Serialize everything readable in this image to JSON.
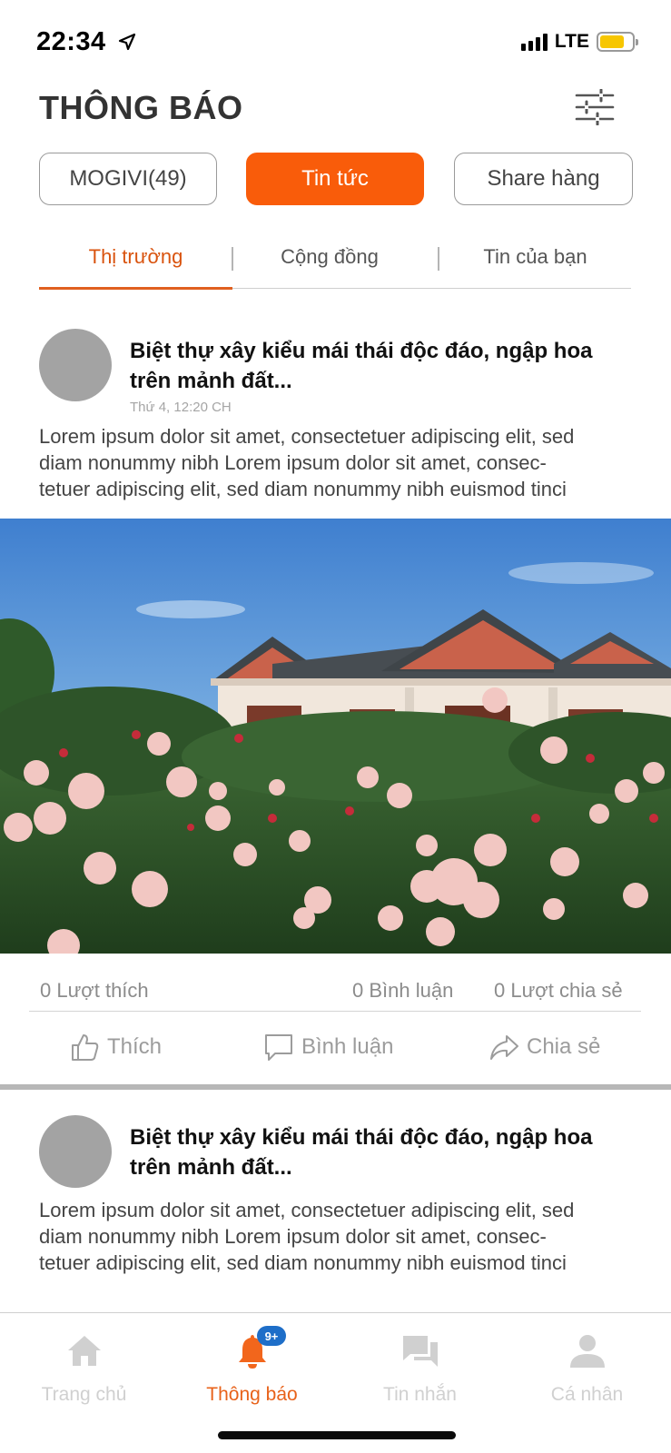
{
  "status_bar": {
    "time": "22:34",
    "network": "LTE",
    "icons": [
      "location-arrow-icon",
      "signal-bars-icon",
      "battery-icon"
    ],
    "battery_color": "#f7c600"
  },
  "header": {
    "title": "THÔNG BÁO",
    "filter_icon": "sliders-icon"
  },
  "segments": [
    {
      "label": "MOGIVI(49)",
      "active": false
    },
    {
      "label": "Tin tức",
      "active": true
    },
    {
      "label": "Share hàng",
      "active": false
    }
  ],
  "tabs": [
    {
      "label": "Thị trường",
      "active": true
    },
    {
      "label": "Cộng đồng",
      "active": false
    },
    {
      "label": "Tin của bạn",
      "active": false
    }
  ],
  "posts": [
    {
      "title_line1": "Biệt thự xây kiểu mái thái độc đáo, ngập hoa",
      "title_line2": "trên mảnh đất...",
      "time": "Thứ 4, 12:20 CH",
      "body_line1": "Lorem ipsum dolor sit amet, consectetuer adipiscing elit, sed",
      "body_line2": "diam nonummy nibh Lorem ipsum dolor sit amet, consec-",
      "body_line3": "tetuer adipiscing elit, sed diam nonummy nibh euismod tinci",
      "likes": "0 Lượt thích",
      "comments": "0 Bình luận",
      "shares": "0 Lượt chia sẻ",
      "actions": {
        "like": "Thích",
        "comment": "Bình luận",
        "share": "Chia sẻ"
      }
    },
    {
      "title_line1": "Biệt thự xây kiểu mái thái độc đáo, ngập hoa",
      "title_line2": "trên mảnh đất...",
      "body_line1": "Lorem ipsum dolor sit amet, consectetuer adipiscing elit, sed",
      "body_line2": "diam nonummy nibh Lorem ipsum dolor sit amet, consec-",
      "body_line3": "tetuer adipiscing elit, sed diam nonummy nibh euismod tinci"
    }
  ],
  "bottom_nav": {
    "items": [
      {
        "label": "Trang chủ",
        "icon": "home-icon",
        "active": false
      },
      {
        "label": "Thông báo",
        "icon": "bell-icon",
        "active": true,
        "badge": "9+"
      },
      {
        "label": "Tin nhắn",
        "icon": "chat-icon",
        "active": false
      },
      {
        "label": "Cá nhân",
        "icon": "person-icon",
        "active": false
      }
    ]
  },
  "colors": {
    "accent": "#f95c0a",
    "tab_active": "#d9530e",
    "badge": "#1e6ec8",
    "nav_inactive": "#d0d0d0"
  }
}
